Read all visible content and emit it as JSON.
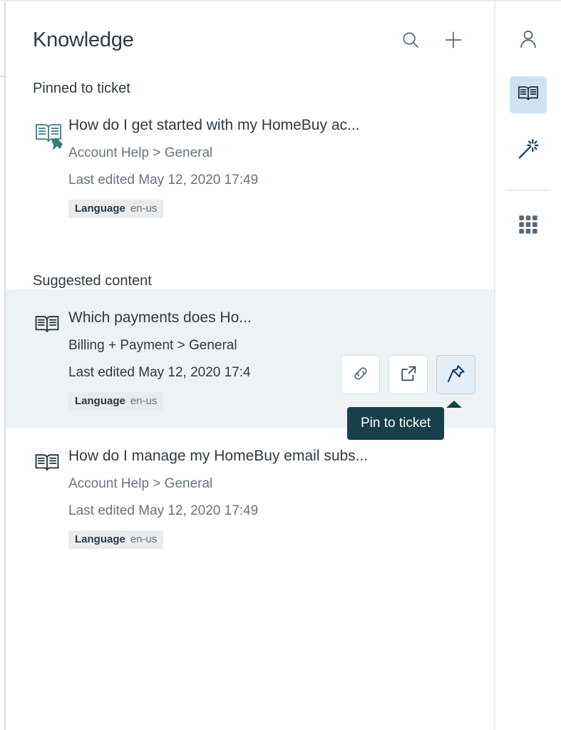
{
  "panel": {
    "title": "Knowledge",
    "search_icon": "search-icon",
    "add_icon": "plus-icon"
  },
  "sections": {
    "pinned_heading": "Pinned to ticket",
    "suggested_heading": "Suggested content"
  },
  "pinned_articles": [
    {
      "icon": "book-pinned-icon",
      "title": "How do I get started with my HomeBuy ac...",
      "path": "Account Help > General",
      "edited": "Last edited May 12, 2020 17:49",
      "language_key": "Language",
      "language_value": "en-us"
    }
  ],
  "suggested_articles": [
    {
      "icon": "book-icon",
      "title": "Which payments does Ho...",
      "path": "Billing + Payment > General",
      "edited": "Last edited May 12, 2020 17:4",
      "language_key": "Language",
      "language_value": "en-us",
      "highlighted": true
    },
    {
      "icon": "book-icon",
      "title": "How do I manage my HomeBuy email subs...",
      "path": "Account Help > General",
      "edited": "Last edited May 12, 2020 17:49",
      "language_key": "Language",
      "language_value": "en-us",
      "highlighted": false
    }
  ],
  "row_actions": [
    {
      "name": "copy-link-button",
      "icon": "link-icon",
      "hovered": false
    },
    {
      "name": "open-in-new-tab-button",
      "icon": "external-link-icon",
      "hovered": false
    },
    {
      "name": "pin-to-ticket-button",
      "icon": "pin-icon",
      "hovered": true
    }
  ],
  "tooltip": {
    "text": "Pin to ticket"
  },
  "right_rail": [
    {
      "name": "customer-context-button",
      "icon": "user-icon",
      "active": false
    },
    {
      "name": "knowledge-button",
      "icon": "book-icon",
      "active": true
    },
    {
      "name": "suggestions-button",
      "icon": "magic-wand-icon",
      "active": false
    },
    {
      "name": "apps-button",
      "icon": "apps-grid-icon",
      "active": false
    }
  ],
  "colors": {
    "text_primary": "#2f3941",
    "text_secondary": "#68737d",
    "highlight_row_bg": "#edf2f5",
    "active_rail_bg": "#cee2f2",
    "tooltip_bg": "#17404b",
    "pinned_icon": "#3f7a7f",
    "action_hover_bg": "#e3eef7",
    "border": "#e9ebed"
  }
}
